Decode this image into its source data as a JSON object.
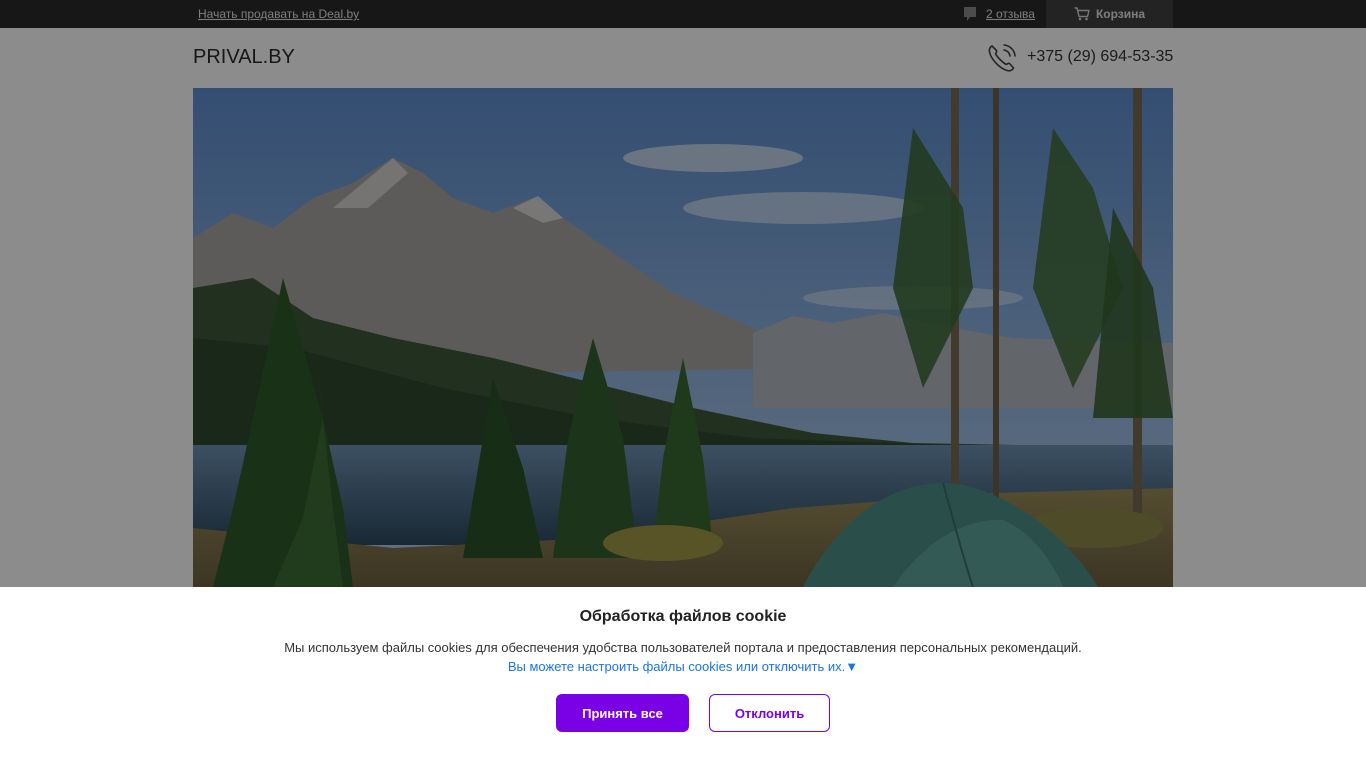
{
  "topbar": {
    "sell_link": "Начать продавать на Deal.by",
    "reviews_label": "2 отзыва",
    "reviews_icon": "comment-icon",
    "cart_label": "Корзина",
    "cart_icon": "cart-icon"
  },
  "header": {
    "logo": "PRIVAL.BY",
    "phone_icon": "phone-icon",
    "phone": "+375 (29) 694-53-35"
  },
  "hero": {
    "image": "mountain-lake-camping-tent-photo"
  },
  "cookie_banner": {
    "title": "Обработка файлов cookie",
    "description": "Мы используем файлы cookies для обеспечения удобства пользователей портала и предоставления персональных рекомендаций.",
    "settings_link": "Вы можете настроить файлы cookies или отключить их.",
    "settings_arrow": "▼",
    "accept_label": "Принять все",
    "decline_label": "Отклонить"
  },
  "colors": {
    "topbar_bg": "#2b2b2b",
    "accent": "#7a00e6",
    "link": "#1a73e8"
  }
}
